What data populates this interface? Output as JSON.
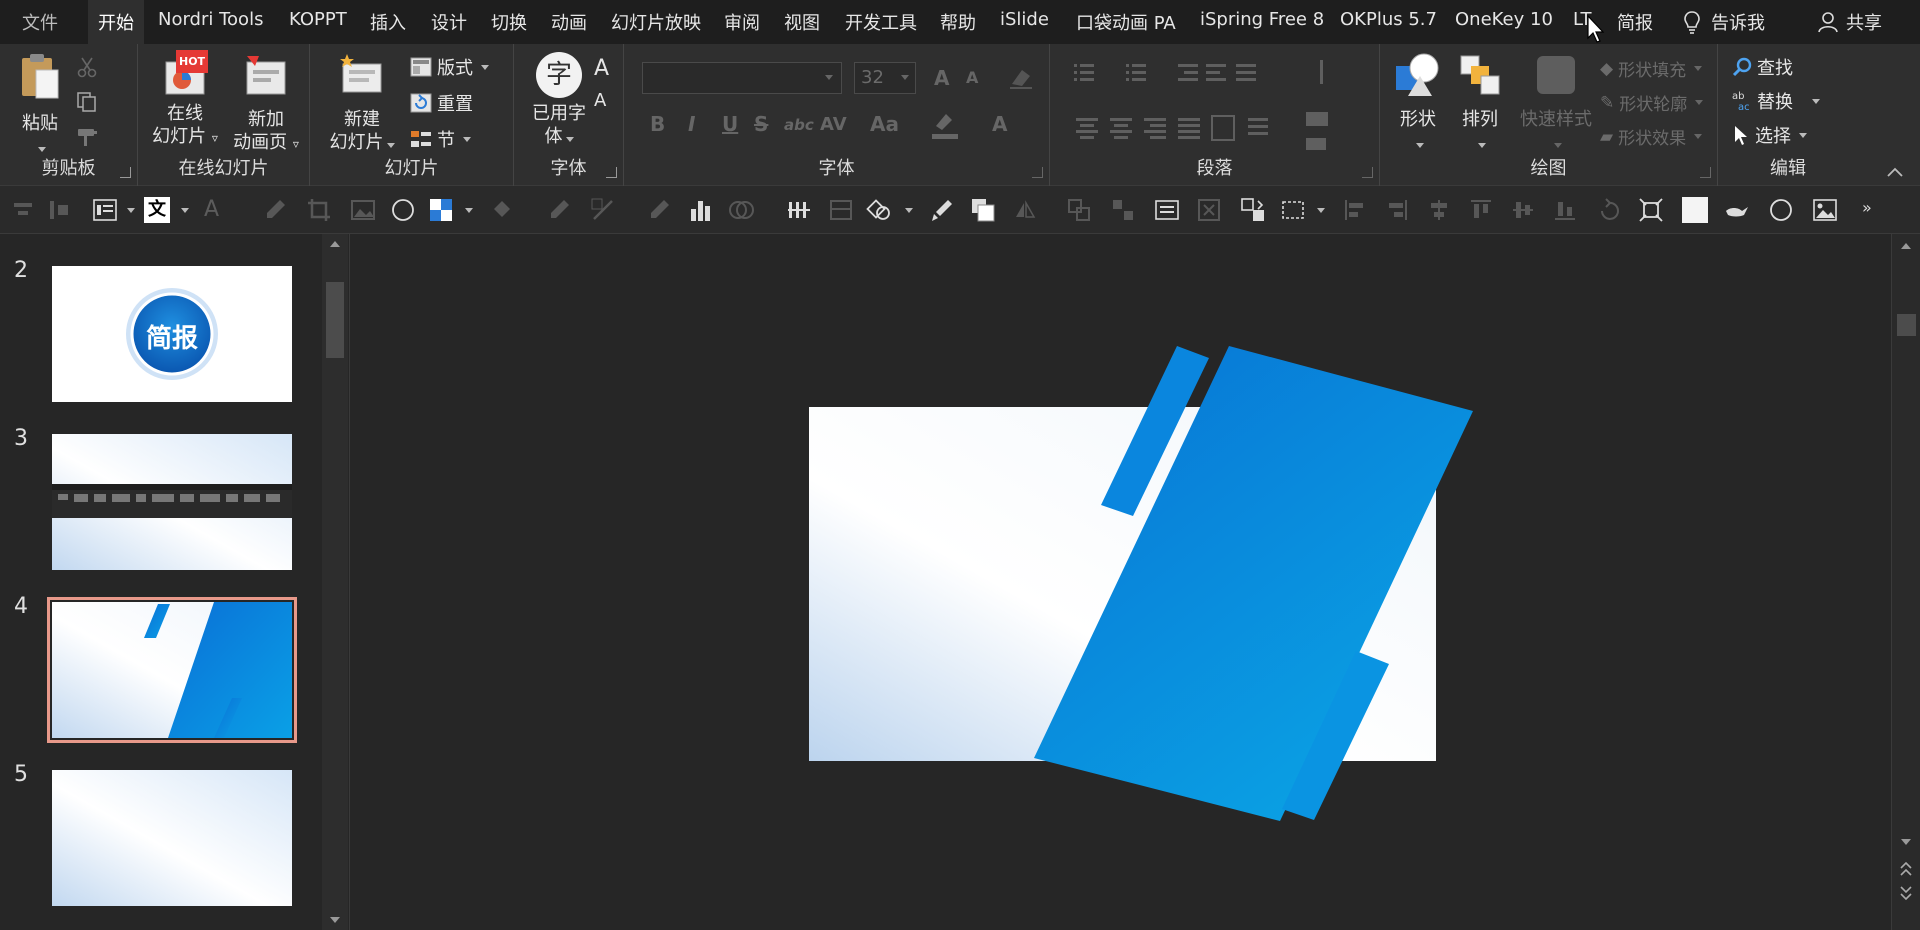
{
  "tabs": [
    {
      "id": "file",
      "label": "文件"
    },
    {
      "id": "home",
      "label": "开始",
      "active": true
    },
    {
      "id": "nordri",
      "label": "Nordri Tools"
    },
    {
      "id": "koppt",
      "label": "KOPPT"
    },
    {
      "id": "insert",
      "label": "插入"
    },
    {
      "id": "design",
      "label": "设计"
    },
    {
      "id": "transitions",
      "label": "切换"
    },
    {
      "id": "animations",
      "label": "动画"
    },
    {
      "id": "slideshow",
      "label": "幻灯片放映"
    },
    {
      "id": "review",
      "label": "审阅"
    },
    {
      "id": "view",
      "label": "视图"
    },
    {
      "id": "developer",
      "label": "开发工具"
    },
    {
      "id": "help",
      "label": "帮助"
    },
    {
      "id": "islide",
      "label": "iSlide"
    },
    {
      "id": "pocket-anim",
      "label": "口袋动画 PA"
    },
    {
      "id": "ispring",
      "label": "iSpring Free 8"
    },
    {
      "id": "okplus",
      "label": "OKPlus 5.7"
    },
    {
      "id": "onekey",
      "label": "OneKey 10"
    },
    {
      "id": "lt",
      "label": "LT"
    },
    {
      "id": "jianbao",
      "label": "简报"
    }
  ],
  "tell_me": "告诉我",
  "share": "共享",
  "ribbon": {
    "clipboard": {
      "label": "剪贴板",
      "paste": "粘贴"
    },
    "online_slides": {
      "label": "在线幻灯片",
      "online_slide": [
        "在线",
        "幻灯片"
      ],
      "new_anim_page": [
        "新加",
        "动画页"
      ],
      "hot_badge": "HOT"
    },
    "slides": {
      "label": "幻灯片",
      "new_slide": [
        "新建",
        "幻灯片"
      ],
      "layout": "版式",
      "reset": "重置",
      "section": "节"
    },
    "used_fonts": {
      "label": "字体",
      "btn": [
        "已用字",
        "体"
      ],
      "glyph": "字",
      "grow_glyph": "A",
      "shrink_glyph": "A"
    },
    "font": {
      "label": "字体",
      "size": "32",
      "bold": "B",
      "italic": "I",
      "underline": "U",
      "strike": "S",
      "shadow": "abc",
      "spacing": "AV",
      "case": "Aa",
      "color_a": "A"
    },
    "paragraph": {
      "label": "段落"
    },
    "drawing": {
      "label": "绘图",
      "shape": "形状",
      "arrange": "排列",
      "quick_styles": "快速样式",
      "fill": "形状填充",
      "outline": "形状轮廓",
      "effects": "形状效果"
    },
    "editing": {
      "label": "编辑",
      "find": "查找",
      "replace": "替换",
      "select": "选择"
    }
  },
  "slides": [
    {
      "num": "2",
      "badge_text": "简报"
    },
    {
      "num": "3"
    },
    {
      "num": "4",
      "selected": true
    },
    {
      "num": "5"
    }
  ],
  "colors": {
    "accent_blue": "#0a7fd9",
    "selection_outline": "#e8998a",
    "hot_red": "#e53935"
  }
}
